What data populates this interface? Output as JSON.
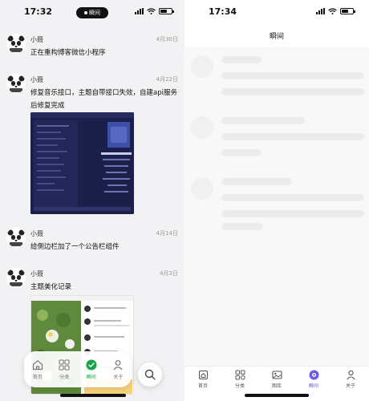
{
  "left_screen": {
    "status": {
      "time": "17:32",
      "island_label": "瞬间"
    },
    "posts": [
      {
        "author": "小聂",
        "date": "4月30日",
        "content": "正在重构博客微信小程序"
      },
      {
        "author": "小聂",
        "date": "4月22日",
        "content": "修复音乐接口，主题自带接口失效，自建api服务后修复完成"
      },
      {
        "author": "小聂",
        "date": "4月14日",
        "content": "给侧边栏加了一个公告栏组件"
      },
      {
        "author": "小聂",
        "date": "4月3日",
        "content": "主题美化记录"
      }
    ],
    "tabbar": {
      "items": [
        {
          "label": "首页",
          "icon": "home-icon"
        },
        {
          "label": "分类",
          "icon": "grid-icon"
        },
        {
          "label": "瞬间",
          "icon": "check-circle-icon"
        },
        {
          "label": "关于",
          "icon": "person-icon"
        }
      ],
      "active_index": 2
    },
    "search_icon": "search-icon"
  },
  "right_screen": {
    "status": {
      "time": "17:34"
    },
    "title": "瞬间",
    "bottom_nav": {
      "items": [
        {
          "label": "首页",
          "icon": "home-icon"
        },
        {
          "label": "分类",
          "icon": "grid-icon"
        },
        {
          "label": "图库",
          "icon": "image-icon"
        },
        {
          "label": "瞬间",
          "icon": "moment-icon"
        },
        {
          "label": "关于",
          "icon": "person-icon"
        }
      ],
      "active_index": 3
    }
  },
  "colors": {
    "left_background": "#f2f2f4",
    "active_green": "#16a34a",
    "active_purple": "#6d5be0",
    "skeleton": "#ececee"
  }
}
